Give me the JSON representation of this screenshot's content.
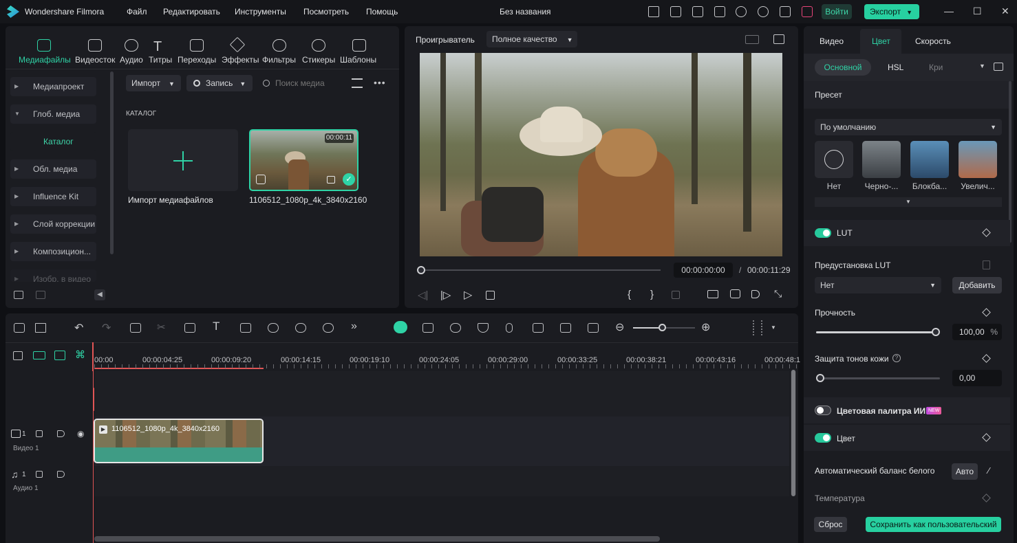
{
  "app": {
    "name": "Wondershare Filmora",
    "project_title": "Без названия",
    "menu": [
      "Файл",
      "Редактировать",
      "Инструменты",
      "Посмотреть",
      "Помощь"
    ],
    "login": "Войти",
    "export": "Экспорт"
  },
  "toolbar": {
    "tabs": [
      "Медиафайлы",
      "Видеосток",
      "Аудио",
      "Титры",
      "Переходы",
      "Эффекты",
      "Фильтры",
      "Стикеры",
      "Шаблоны"
    ]
  },
  "sidebar": {
    "items": [
      "Медиапроект",
      "Глоб. медиа",
      "Каталог",
      "Обл. медиа",
      "Influence Kit",
      "Слой коррекции",
      "Композицион...",
      "Изобр. в видео"
    ]
  },
  "media": {
    "import_label": "Импорт",
    "record_label": "Запись",
    "search_placeholder": "Поиск медиа",
    "catalog_heading": "КАТАЛОГ",
    "import_tile_label": "Импорт медиафайлов",
    "clip_name": "1106512_1080p_4k_3840x2160",
    "clip_duration": "00:00:11"
  },
  "player": {
    "label": "Проигрыватель",
    "quality": "Полное качество",
    "current_time": "00:00:00:00",
    "separator": "/",
    "total_time": "00:00:11:29"
  },
  "right_panel": {
    "tabs": [
      "Видео",
      "Цвет",
      "Скорость"
    ],
    "subtabs": [
      "Основной",
      "HSL",
      "Кри"
    ],
    "preset_heading": "Пресет",
    "preset_select": "По умолчанию",
    "presets": [
      "Нет",
      "Черно-...",
      "Блокба...",
      "Увелич..."
    ],
    "lut_label": "LUT",
    "lut_preset_label": "Предустановка LUT",
    "lut_select": "Нет",
    "add_button": "Добавить",
    "strength_label": "Прочность",
    "strength_value": "100,00",
    "percent": "%",
    "skin_label": "Защита тонов кожи",
    "skin_value": "0,00",
    "ai_palette_label": "Цветовая палитра ИИ",
    "new_badge": "NEW",
    "color_label": "Цвет",
    "awb_label": "Автоматический баланс белого",
    "auto_button": "Авто",
    "temperature_label": "Температура",
    "reset_button": "Сброс",
    "save_custom_button": "Сохранить как пользовательский",
    "strength_level": 1.0,
    "skin_level": 0.0
  },
  "timeline": {
    "ruler": [
      "00:00",
      "00:00:04:25",
      "00:00:09:20",
      "00:00:14:15",
      "00:00:19:10",
      "00:00:24:05",
      "00:00:29:00",
      "00:00:33:25",
      "00:00:38:21",
      "00:00:43:16",
      "00:00:48:1"
    ],
    "video_track": {
      "num": "1",
      "name": "Видео 1"
    },
    "audio_track": {
      "num": "1",
      "name": "Аудио 1"
    },
    "clip_label": "1106512_1080p_4k_3840x2160"
  },
  "colors": {
    "accent": "#27d0a0",
    "clip_green": "#3f9c85",
    "playhead": "#e25555"
  }
}
